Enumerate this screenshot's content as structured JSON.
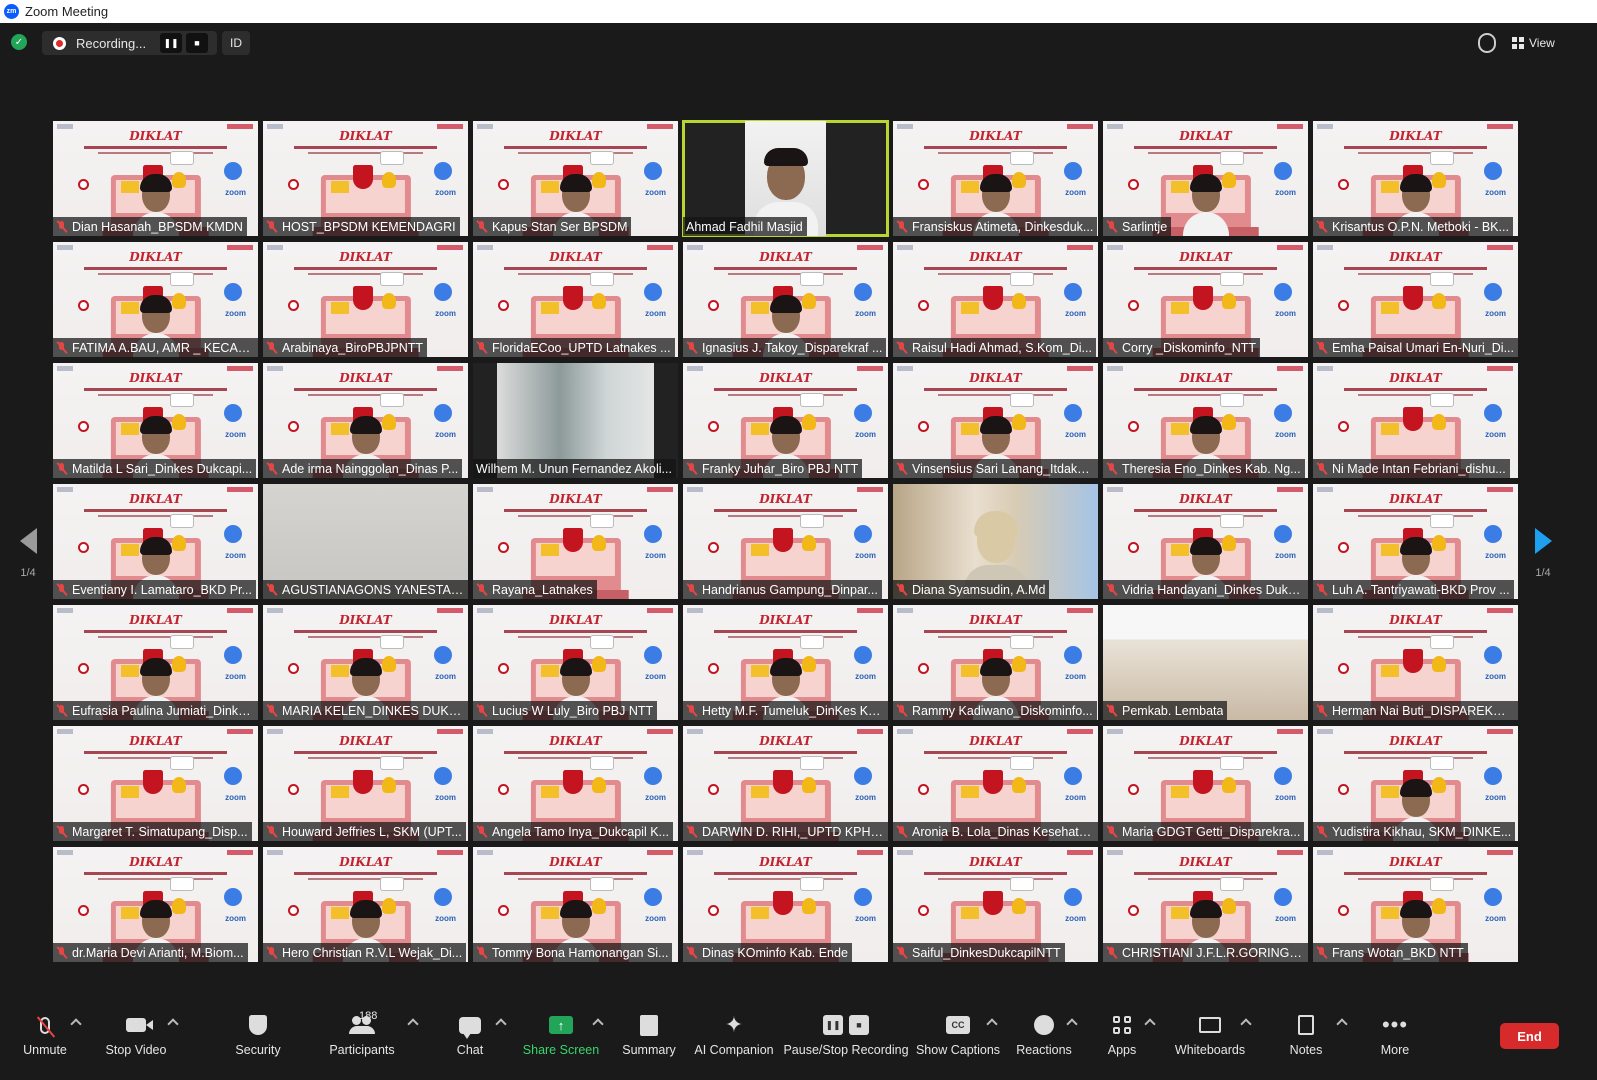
{
  "window": {
    "title": "Zoom Meeting",
    "logo": "zm"
  },
  "topbar": {
    "recording_label": "Recording...",
    "id_label": "ID",
    "view_label": "View",
    "pause_glyph": "❚❚",
    "stop_glyph": "■"
  },
  "pager": {
    "left": "1/4",
    "right": "1/4"
  },
  "participants": [
    {
      "name": "Dian Hasanah_BPSDM KMDN",
      "muted": true,
      "bg": "slide-person"
    },
    {
      "name": "HOST_BPSDM KEMENDAGRI",
      "muted": true,
      "bg": "slide"
    },
    {
      "name": "Kapus Stan Ser BPSDM",
      "muted": true,
      "bg": "slide-person"
    },
    {
      "name": "Ahmad Fadhil Masjid",
      "muted": false,
      "bg": "person-white",
      "active": true
    },
    {
      "name": "Fransiskus Atimeta, Dinkesduk...",
      "muted": true,
      "bg": "slide-person"
    },
    {
      "name": "Sarlintje",
      "muted": true,
      "bg": "slide-person"
    },
    {
      "name": "Krisantus O.P.N. Metboki - BK...",
      "muted": true,
      "bg": "slide-person"
    },
    {
      "name": "FATIMA A.BAU, AMR _ KECAM...",
      "muted": true,
      "bg": "slide-person"
    },
    {
      "name": "Arabinaya_BiroPBJPNTT",
      "muted": true,
      "bg": "slide"
    },
    {
      "name": "FloridaECoo_UPTD Latnakes ...",
      "muted": true,
      "bg": "slide"
    },
    {
      "name": "Ignasius J. Takoy_Disparekraf ...",
      "muted": true,
      "bg": "slide-person"
    },
    {
      "name": "Raisul Hadi Ahmad, S.Kom_Di...",
      "muted": true,
      "bg": "slide"
    },
    {
      "name": "Corry _Diskominfo_NTT",
      "muted": true,
      "bg": "slide"
    },
    {
      "name": "Emha Paisal Umari En-Nuri_Di...",
      "muted": true,
      "bg": "slide"
    },
    {
      "name": "Matilda L Sari_Dinkes Dukcapi...",
      "muted": true,
      "bg": "slide-person"
    },
    {
      "name": "Ade irma Nainggolan_Dinas P...",
      "muted": true,
      "bg": "slide-person"
    },
    {
      "name": "Wilhem M. Unun Fernandez Akoli...",
      "muted": false,
      "bg": "window"
    },
    {
      "name": "Franky Juhar_Biro PBJ NTT",
      "muted": true,
      "bg": "slide-person"
    },
    {
      "name": "Vinsensius Sari Lanang_Itdaka...",
      "muted": true,
      "bg": "slide-person"
    },
    {
      "name": "Theresia Eno_Dinkes Kab. Ng...",
      "muted": true,
      "bg": "slide-person"
    },
    {
      "name": "Ni Made Intan Febriani_dishu...",
      "muted": true,
      "bg": "slide"
    },
    {
      "name": "Eventiany I. Lamataro_BKD Pr...",
      "muted": true,
      "bg": "slide-person"
    },
    {
      "name": "AGUSTIANAGONS YANESTA, ...",
      "muted": true,
      "bg": "grey"
    },
    {
      "name": "Rayana_Latnakes",
      "muted": true,
      "bg": "slide"
    },
    {
      "name": "Handrianus Gampung_Dinpar...",
      "muted": true,
      "bg": "slide"
    },
    {
      "name": "Diana Syamsudin, A.Md",
      "muted": true,
      "bg": "curtain"
    },
    {
      "name": "Vidria Handayani_Dinkes Dukc...",
      "muted": true,
      "bg": "slide-person"
    },
    {
      "name": "Luh A. Tantriyawati-BKD Prov ...",
      "muted": true,
      "bg": "slide-person"
    },
    {
      "name": "Eufrasia Paulina Jumiati_Dinke...",
      "muted": true,
      "bg": "slide-person"
    },
    {
      "name": "MARIA KELEN_DINKES DUKC...",
      "muted": true,
      "bg": "slide-person"
    },
    {
      "name": "Lucius W Luly_Biro PBJ NTT",
      "muted": true,
      "bg": "slide-person"
    },
    {
      "name": "Hetty M.F. Tumeluk_DinKes Ka...",
      "muted": true,
      "bg": "slide-person"
    },
    {
      "name": "Rammy Kadiwano_Diskominfo...",
      "muted": true,
      "bg": "slide-person"
    },
    {
      "name": "Pemkab. Lembata",
      "muted": true,
      "bg": "meeting"
    },
    {
      "name": "Herman Nai Buti_DISPAREKRA...",
      "muted": true,
      "bg": "slide"
    },
    {
      "name": "Margaret T. Simatupang_Disp...",
      "muted": true,
      "bg": "slide"
    },
    {
      "name": "Houward Jeffries L, SKM (UPT...",
      "muted": true,
      "bg": "slide"
    },
    {
      "name": "Angela Tamo Inya_Dukcapil K...",
      "muted": true,
      "bg": "slide"
    },
    {
      "name": "DARWIN D. RIHI,_UPTD KPH ...",
      "muted": true,
      "bg": "slide"
    },
    {
      "name": "Aronia B. Lola_Dinas Kesehata...",
      "muted": true,
      "bg": "slide"
    },
    {
      "name": "Maria GDGT Getti_Disparekra...",
      "muted": true,
      "bg": "slide"
    },
    {
      "name": "Yudistira Kikhau, SKM_DINKE...",
      "muted": true,
      "bg": "slide-person"
    },
    {
      "name": "dr.Maria Devi Arianti, M.Biom...",
      "muted": true,
      "bg": "slide-person"
    },
    {
      "name": "Hero Christian R.V.L Wejak_Di...",
      "muted": true,
      "bg": "slide-person"
    },
    {
      "name": "Tommy Bona Hamonangan Si...",
      "muted": true,
      "bg": "slide-person"
    },
    {
      "name": "Dinas KOminfo Kab. Ende",
      "muted": true,
      "bg": "slide"
    },
    {
      "name": "Saiful_DinkesDukcapilNTT",
      "muted": true,
      "bg": "slide"
    },
    {
      "name": "CHRISTIANI J.F.L.R.GORING, S...",
      "muted": true,
      "bg": "slide-person"
    },
    {
      "name": "Frans Wotan_BKD NTT",
      "muted": true,
      "bg": "slide-person"
    }
  ],
  "slide": {
    "heading": "DIKLAT",
    "zoom_text": "zoom"
  },
  "toolbar": {
    "unmute": "Unmute",
    "stop_video": "Stop Video",
    "security": "Security",
    "participants": "Participants",
    "participants_count": "188",
    "chat": "Chat",
    "share_screen": "Share Screen",
    "summary": "Summary",
    "ai_companion": "AI Companion",
    "pause_stop_recording": "Pause/Stop Recording",
    "show_captions": "Show Captions",
    "reactions": "Reactions",
    "apps": "Apps",
    "whiteboards": "Whiteboards",
    "notes": "Notes",
    "more": "More",
    "end": "End",
    "cc_glyph": "CC",
    "share_glyph": "↑",
    "ai_glyph": "✦",
    "more_glyph": "•••"
  },
  "colors": {
    "active_speaker": "#b7d630",
    "end_button": "#d72b2b",
    "share_green": "#23a559",
    "next_page_arrow": "#1ea0f0"
  }
}
